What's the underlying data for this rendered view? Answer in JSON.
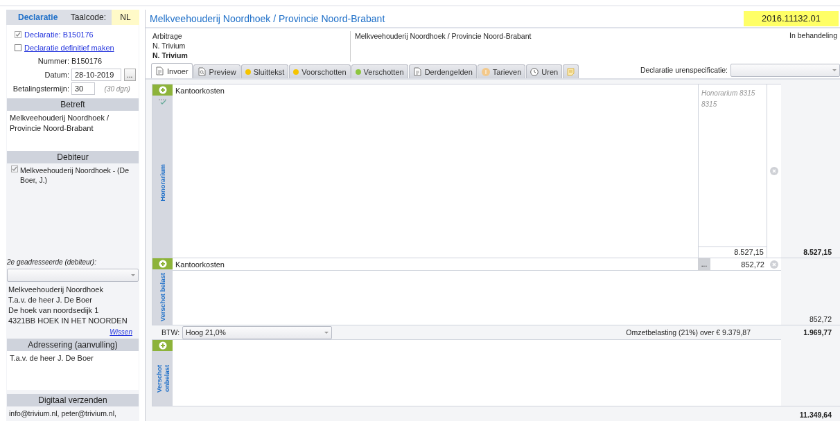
{
  "sidebar": {
    "title": "Declaratie",
    "taalcode_label": "Taalcode:",
    "taalcode": "NL",
    "declaratie": {
      "label": "Declaratie: B150176",
      "checked": true
    },
    "definitief": {
      "label": "Declaratie definitief maken",
      "checked": false
    },
    "fields": [
      {
        "kind": "text",
        "label": "Nummer:",
        "value": "B150176"
      },
      {
        "kind": "date",
        "label": "Datum:",
        "value": "28-10-2019",
        "button": "..."
      },
      {
        "kind": "input",
        "label": "Betalingstermijn:",
        "value": "30",
        "hint": "(30 dgn)"
      }
    ],
    "betreft": {
      "title": "Betreft",
      "text": "Melkveehouderij Noordhoek / Provincie Noord-Brabant"
    },
    "debiteur": {
      "title": "Debiteur",
      "items": [
        {
          "label": "Melkveehouderij Noordhoek - (De Boer, J.)",
          "checked": true
        }
      ]
    },
    "second_addressee": {
      "label": "2e geadresseerde (debiteur):"
    },
    "address_lines": [
      "Melkveehouderij Noordhoek",
      "T.a.v. de heer J. De Boer",
      "De hoek van noordsedijk 1",
      "4321BB  HOEK IN HET NOORDEN"
    ],
    "wissen": "Wissen",
    "adressering": {
      "title": "Adressering (aanvulling)",
      "text": "T.a.v. de heer J. De Boer"
    },
    "digitaal": {
      "title": "Digitaal verzenden",
      "text": "info@trivium.nl, peter@trivium.nl,"
    }
  },
  "header": {
    "title": "Melkveehouderij Noordhoek / Provincie Noord-Brabant",
    "code": "2016.11132.01"
  },
  "info": {
    "left": [
      {
        "text": "Arbitrage",
        "bold": false
      },
      {
        "text": "N. Trivium",
        "bold": false
      },
      {
        "text": "N. Trivium",
        "bold": true
      }
    ],
    "middle": "Melkveehouderij Noordhoek / Provincie Noord-Brabant",
    "status": "In behandeling"
  },
  "tabs": [
    {
      "label": "Invoer",
      "kind": "doc",
      "selected": true
    },
    {
      "label": "Preview",
      "kind": "preview",
      "selected": false
    },
    {
      "label": "Sluittekst",
      "kind": "dot",
      "color": "#f5c400",
      "selected": false
    },
    {
      "label": "Voorschotten",
      "kind": "dot",
      "color": "#f5c400",
      "selected": false
    },
    {
      "label": "Verschotten",
      "kind": "dot",
      "color": "#8dc63f",
      "selected": false
    },
    {
      "label": "Derdengelden",
      "kind": "doc",
      "selected": false
    },
    {
      "label": "Tarieven",
      "kind": "coin",
      "color": "#f3c98b",
      "selected": false
    },
    {
      "label": "Uren",
      "kind": "clock",
      "selected": false
    },
    {
      "kind": "note",
      "selected": false
    }
  ],
  "urenspecificatie": {
    "label": "Declaratie urenspecificatie:"
  },
  "honorarium": {
    "label": "Honorarium",
    "description": "Kantoorkosten",
    "note": [
      "Honorarium 8315",
      "8315"
    ],
    "amount": "8.527,15",
    "total": "8.527,15"
  },
  "verschot_belast": {
    "label": "Verschot belast",
    "description": "Kantoorkosten",
    "button": "...",
    "amount": "852,72",
    "total": "852,72"
  },
  "btw": {
    "label": "BTW:",
    "value": "Hoog 21,0%",
    "summary": "Omzetbelasting (21%) over € 9.379,87",
    "total": "1.969,77"
  },
  "verschot_onbelast": {
    "label": "Verschot onbelast"
  },
  "grand_total": "11.349,64"
}
